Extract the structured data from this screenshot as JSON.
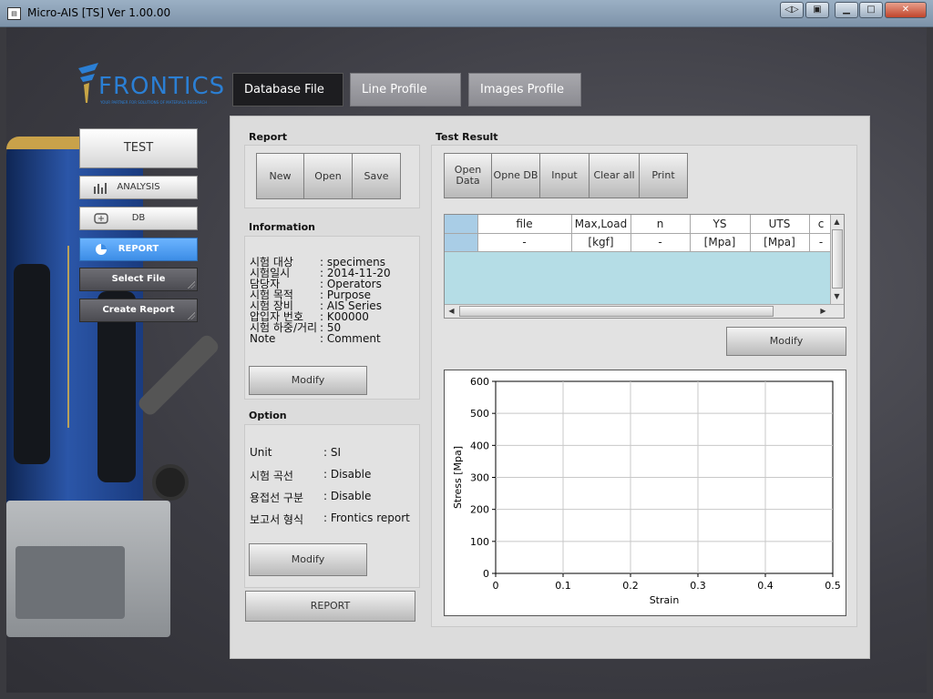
{
  "window": {
    "title": "Micro-AIS [TS] Ver 1.00.00",
    "controls": [
      "restore",
      "minimize",
      "maximize",
      "close"
    ]
  },
  "logo": {
    "text": "FRONTICS",
    "tagline": "YOUR PARTNER FOR SOLUTIONS OF MATERIALS RESEARCH"
  },
  "nav": {
    "test": "TEST",
    "analysis": "ANALYSIS",
    "db": "DB",
    "report": "REPORT",
    "select_file": "Select File",
    "create_report": "Create Report",
    "active": "REPORT",
    "active_color": "#3c8de6"
  },
  "tabs": [
    {
      "label": "Database File",
      "active": true
    },
    {
      "label": "Line Profile",
      "active": false
    },
    {
      "label": "Images Profile",
      "active": false
    }
  ],
  "report": {
    "label": "Report",
    "buttons": {
      "new": "New",
      "open": "Open",
      "save": "Save"
    }
  },
  "information": {
    "label": "Information",
    "rows": [
      {
        "key": "시험 대상",
        "value": ": specimens"
      },
      {
        "key": "시험일시",
        "value": ": 2014-11-20"
      },
      {
        "key": "담당자",
        "value": ": Operators"
      },
      {
        "key": "시험 목적",
        "value": ": Purpose"
      },
      {
        "key": "시험 장비",
        "value": ": AIS Series"
      },
      {
        "key": "압입자 번호",
        "value": ": K00000"
      },
      {
        "key": "시험 하중/거리",
        "value": ": 50"
      },
      {
        "key": "Note",
        "value": ": Comment"
      }
    ],
    "modify": "Modify"
  },
  "option": {
    "label": "Option",
    "rows": [
      {
        "key": "Unit",
        "value": ": SI"
      },
      {
        "key": "시험 곡선",
        "value": ": Disable"
      },
      {
        "key": "용접선 구분",
        "value": ": Disable"
      },
      {
        "key": "보고서 형식",
        "value": ": Frontics report"
      }
    ],
    "modify": "Modify",
    "report_button": "REPORT"
  },
  "test_result": {
    "label": "Test Result",
    "toolbar": {
      "open_data": "Open Data",
      "opne_db": "Opne DB",
      "input": "Input",
      "clear_all": "Clear all",
      "print": "Print"
    },
    "grid": {
      "columns": [
        "file",
        "Max,Load",
        "n",
        "YS",
        "UTS",
        "c"
      ],
      "units": [
        "-",
        "[kgf]",
        "-",
        "[Mpa]",
        "[Mpa]",
        "-"
      ]
    },
    "modify": "Modify"
  },
  "chart_data": {
    "type": "line",
    "title": "",
    "xlabel": "Strain",
    "ylabel": "Stress [Mpa]",
    "xlim": [
      0,
      0.5
    ],
    "ylim": [
      0,
      600
    ],
    "xticks": [
      "0",
      "0.1",
      "0.2",
      "0.3",
      "0.4",
      "0.5"
    ],
    "yticks": [
      "0",
      "100",
      "200",
      "300",
      "400",
      "500",
      "600"
    ],
    "grid": true,
    "series": []
  }
}
